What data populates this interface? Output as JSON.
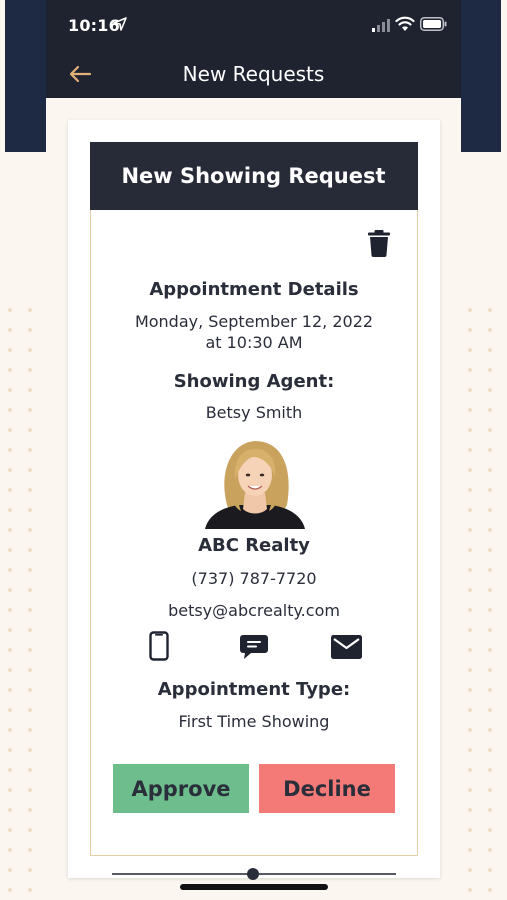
{
  "status_bar": {
    "time": "10:16"
  },
  "app_bar": {
    "title": "New Requests"
  },
  "card": {
    "header": "New Showing Request",
    "appointment_details_label": "Appointment Details",
    "appointment_date": "Monday, September 12, 2022",
    "appointment_time": "at 10:30 AM",
    "showing_agent_label": "Showing Agent:",
    "agent_name": "Betsy Smith",
    "brokerage": "ABC Realty",
    "phone": "(737) 787-7720",
    "email": "betsy@abcrealty.com",
    "appointment_type_label": "Appointment Type:",
    "appointment_type": "First Time Showing",
    "approve_label": "Approve",
    "decline_label": "Decline"
  },
  "colors": {
    "dark_navy": "#1f2330",
    "card_header": "#272b38",
    "approve": "#6dbe8c",
    "decline": "#f47a78",
    "back_arrow": "#e3b07a",
    "card_border": "#e3cfa8"
  },
  "icons": [
    "location-arrow-icon",
    "cellular-signal-icon",
    "wifi-icon",
    "battery-icon",
    "back-arrow-icon",
    "trash-icon",
    "mobile-phone-icon",
    "chat-bubble-icon",
    "mail-icon"
  ]
}
